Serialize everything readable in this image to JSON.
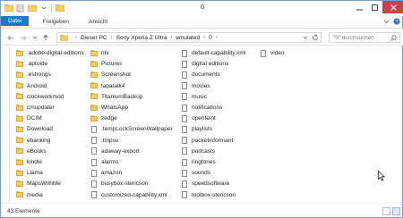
{
  "window": {
    "title": "0"
  },
  "ribbon": {
    "tabs": [
      {
        "label": "Datei",
        "active": true
      },
      {
        "label": "Start"
      },
      {
        "label": "Freigeben"
      },
      {
        "label": "Ansicht"
      }
    ]
  },
  "address": {
    "breadcrumbs": [
      "Dieser PC",
      "Sony Xperia Z Ultra",
      "emulated",
      "0"
    ]
  },
  "search": {
    "placeholder": "\"0\" durchsuchen"
  },
  "files": {
    "col1": [
      {
        "name": ".adobe-digital-editions",
        "type": "folder"
      },
      {
        "name": ".aptoide",
        "type": "folder"
      },
      {
        "name": ".estrongs",
        "type": "folder"
      },
      {
        "name": "Android",
        "type": "folder"
      },
      {
        "name": "clockworkmod",
        "type": "folder"
      },
      {
        "name": "cmupdater",
        "type": "folder"
      },
      {
        "name": "DCIM",
        "type": "folder"
      },
      {
        "name": "Download",
        "type": "folder"
      },
      {
        "name": "ebanking",
        "type": "folder"
      },
      {
        "name": "eBooks",
        "type": "folder"
      },
      {
        "name": "kindle",
        "type": "folder"
      },
      {
        "name": "Llama",
        "type": "folder"
      },
      {
        "name": "MapsWithMe",
        "type": "folder"
      },
      {
        "name": "media",
        "type": "folder"
      }
    ],
    "col2": [
      {
        "name": "ntv",
        "type": "folder"
      },
      {
        "name": "Pictures",
        "type": "folder"
      },
      {
        "name": "Screenshot",
        "type": "folder"
      },
      {
        "name": "tapatalk4",
        "type": "folder"
      },
      {
        "name": "TitaniumBackup",
        "type": "folder"
      },
      {
        "name": "WhatsApp",
        "type": "folder"
      },
      {
        "name": "zedge",
        "type": "folder"
      },
      {
        "name": ".tempLockScreenWallpaper",
        "type": "file"
      },
      {
        "name": ".tmpsu",
        "type": "file"
      },
      {
        "name": "adaway-export",
        "type": "file"
      },
      {
        "name": "alarms",
        "type": "file"
      },
      {
        "name": "amazon",
        "type": "file"
      },
      {
        "name": "busybox-stericson",
        "type": "file"
      },
      {
        "name": "customized-capability.xml",
        "type": "file"
      }
    ],
    "col3": [
      {
        "name": "default-capability.xml",
        "type": "file"
      },
      {
        "name": "digital editions",
        "type": "file"
      },
      {
        "name": "documents",
        "type": "file"
      },
      {
        "name": "movies",
        "type": "file"
      },
      {
        "name": "music",
        "type": "file"
      },
      {
        "name": "notifications",
        "type": "file"
      },
      {
        "name": "openfeint",
        "type": "file"
      },
      {
        "name": "playlists",
        "type": "file"
      },
      {
        "name": "pocketinformant",
        "type": "file"
      },
      {
        "name": "podcasts",
        "type": "file"
      },
      {
        "name": "ringtones",
        "type": "file"
      },
      {
        "name": "sounds",
        "type": "file"
      },
      {
        "name": "speedsoftware",
        "type": "file"
      },
      {
        "name": "toolbox-stericson",
        "type": "file"
      }
    ],
    "col4": [
      {
        "name": "video",
        "type": "file"
      }
    ]
  },
  "status": {
    "count": "43 Elemente"
  },
  "colors": {
    "accent": "#1979ca",
    "folder": "#f2cf63",
    "close": "#c7463b"
  }
}
